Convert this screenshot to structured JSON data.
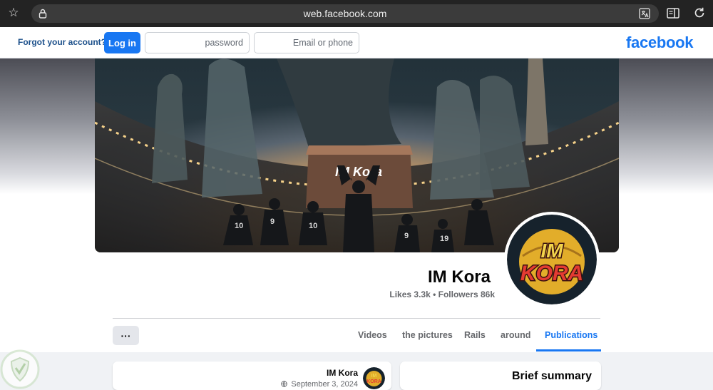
{
  "browser": {
    "url": "web.facebook.com"
  },
  "header": {
    "forgot_account": "Forgot your account?",
    "login_label": "Log in",
    "password_placeholder": "password",
    "email_placeholder": "Email or phone",
    "logo_text": "facebook"
  },
  "cover": {
    "banner_text": "IM Kora"
  },
  "profile": {
    "name": "IM Kora",
    "stats": "Likes 3.3k • Followers 86k",
    "avatar_text_top": "IM",
    "avatar_text_bottom": "KORA"
  },
  "tabs": {
    "more_label": "···",
    "items": [
      "Videos",
      "the pictures",
      "Rails",
      "around",
      "Publications"
    ],
    "active": "Publications"
  },
  "post": {
    "author": "IM Kora",
    "date": "September 3, 2024"
  },
  "summary": {
    "title": "Brief summary"
  },
  "colors": {
    "brand": "#1877f2",
    "link": "#1b4f8a",
    "muted_text": "#65676b"
  }
}
